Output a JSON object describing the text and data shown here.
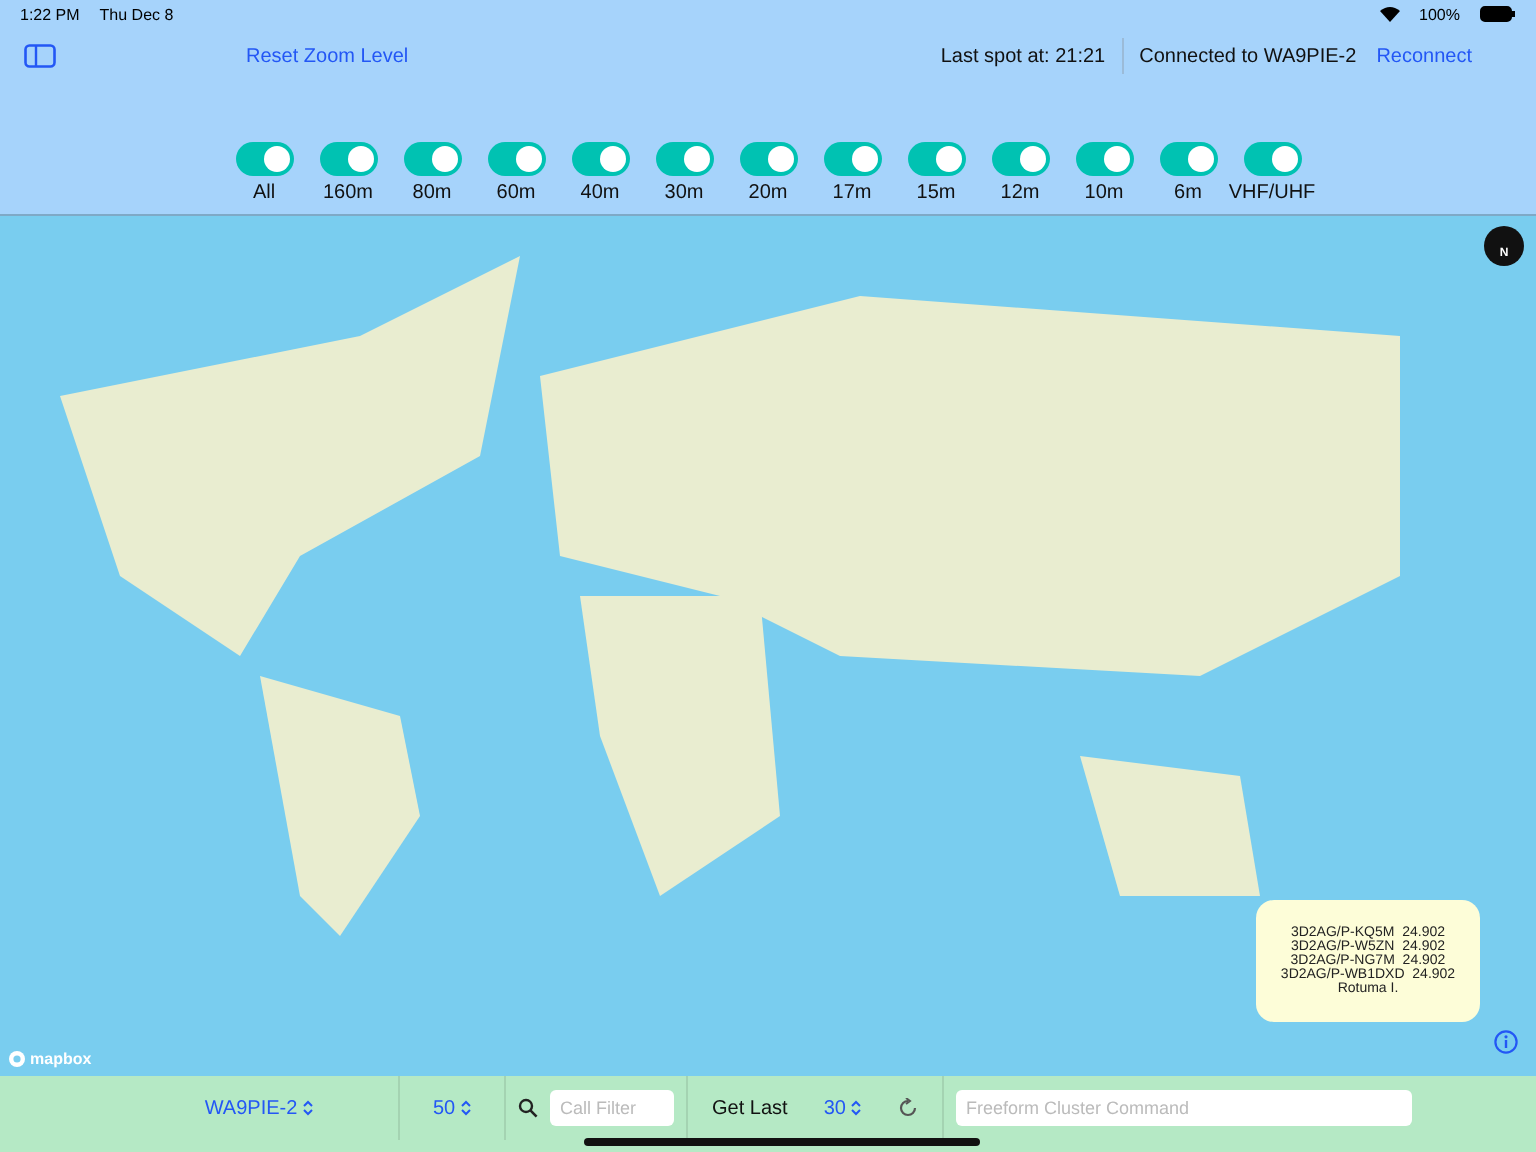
{
  "status_bar": {
    "time": "1:22 PM",
    "date": "Thu Dec 8",
    "battery": "100%"
  },
  "toolbar": {
    "reset": "Reset Zoom Level",
    "last_spot": "Last spot at: 21:21",
    "connected": "Connected to WA9PIE-2",
    "reconnect": "Reconnect"
  },
  "bands": [
    {
      "label": "All",
      "on": true
    },
    {
      "label": "160m",
      "on": true
    },
    {
      "label": "80m",
      "on": true
    },
    {
      "label": "60m",
      "on": true
    },
    {
      "label": "40m",
      "on": true
    },
    {
      "label": "30m",
      "on": true
    },
    {
      "label": "20m",
      "on": true
    },
    {
      "label": "17m",
      "on": true
    },
    {
      "label": "15m",
      "on": true
    },
    {
      "label": "12m",
      "on": true
    },
    {
      "label": "10m",
      "on": true
    },
    {
      "label": "6m",
      "on": true
    },
    {
      "label": "VHF/UHF",
      "on": true
    }
  ],
  "map": {
    "compass": "N",
    "logo": "mapbox",
    "popup": {
      "lines": [
        "3D2AG/P-KQ5M  24.902",
        "3D2AG/P-W5ZN  24.902",
        "3D2AG/P-NG7M  24.902",
        "3D2AG/P-WB1DXD  24.902"
      ],
      "place": "Rotuma I."
    }
  },
  "bottom_bar": {
    "cluster": "WA9PIE-2",
    "count": "50",
    "call_filter": {
      "placeholder": "Call Filter"
    },
    "get_last": "Get Last",
    "last_count": "30",
    "command": {
      "placeholder": "Freeform Cluster Command"
    }
  }
}
